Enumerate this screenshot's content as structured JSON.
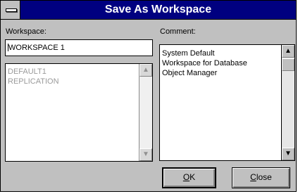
{
  "window": {
    "title": "Save As Workspace",
    "system_menu_icon": "system-menu-icon"
  },
  "workspace": {
    "label": "Workspace:",
    "input_value": "WORKSPACE 1",
    "list_items": [
      "DEFAULT1",
      "REPLICATION"
    ],
    "scroll_up_icon": "scroll-up-arrow-icon",
    "scroll_down_icon": "scroll-down-arrow-icon"
  },
  "comment": {
    "label": "Comment:",
    "lines": [
      "System Default",
      "Workspace for Database",
      "Object Manager"
    ],
    "scroll_up_icon": "scroll-up-arrow-icon",
    "scroll_down_icon": "scroll-down-arrow-icon"
  },
  "buttons": {
    "ok": {
      "mnemonic": "O",
      "rest": "K"
    },
    "close": {
      "mnemonic": "C",
      "rest": "lose"
    }
  },
  "colors": {
    "titlebar": "#000080",
    "face": "#c0c0c0",
    "disabled_text": "#9a9a9a"
  }
}
